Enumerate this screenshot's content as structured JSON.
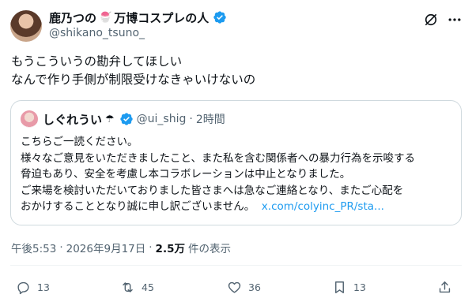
{
  "author": {
    "display_name": "鹿乃つの",
    "name_emoji": "🍧",
    "name_suffix": "万博コスプレの人",
    "handle": "@shikano_tsuno_"
  },
  "icons": {
    "verified": "verified-badge-icon",
    "grok": "grok-icon",
    "more": "more-icon"
  },
  "post": {
    "lines": [
      "もうこういうの勘弁してほしい",
      "なんで作り手側が制限受けなきゃいけないの"
    ]
  },
  "quote": {
    "display_name": "しぐれうい",
    "name_emoji": "☂",
    "handle": "@ui_shig",
    "separator": "·",
    "time": "2時間",
    "lines": [
      "こちらご一読ください。",
      "様々なご意見をいただきましたこと、また私を含む関係者への暴力行為を示唆する",
      "脅迫もあり、安全を考慮し本コラボレーションは中止となりました。",
      "ご来場を検討いただいておりました皆さまへは急なご連絡となり、またご心配を",
      "おかけすることとなり誠に申し訳ございません。"
    ],
    "link": "x.com/colyinc_PR/sta..."
  },
  "meta": {
    "time": "午後5:53",
    "separator": "·",
    "date": "2026年9月17日",
    "separator2": "·",
    "views_count": "2.5万",
    "views_label": "件の表示"
  },
  "actions": {
    "reply_count": "13",
    "retweet_count": "45",
    "like_count": "36",
    "bookmark_count": "13"
  },
  "colors": {
    "accent": "#1d9bf0",
    "text": "#0f1419",
    "secondary": "#536471",
    "border": "#cfd9de"
  }
}
